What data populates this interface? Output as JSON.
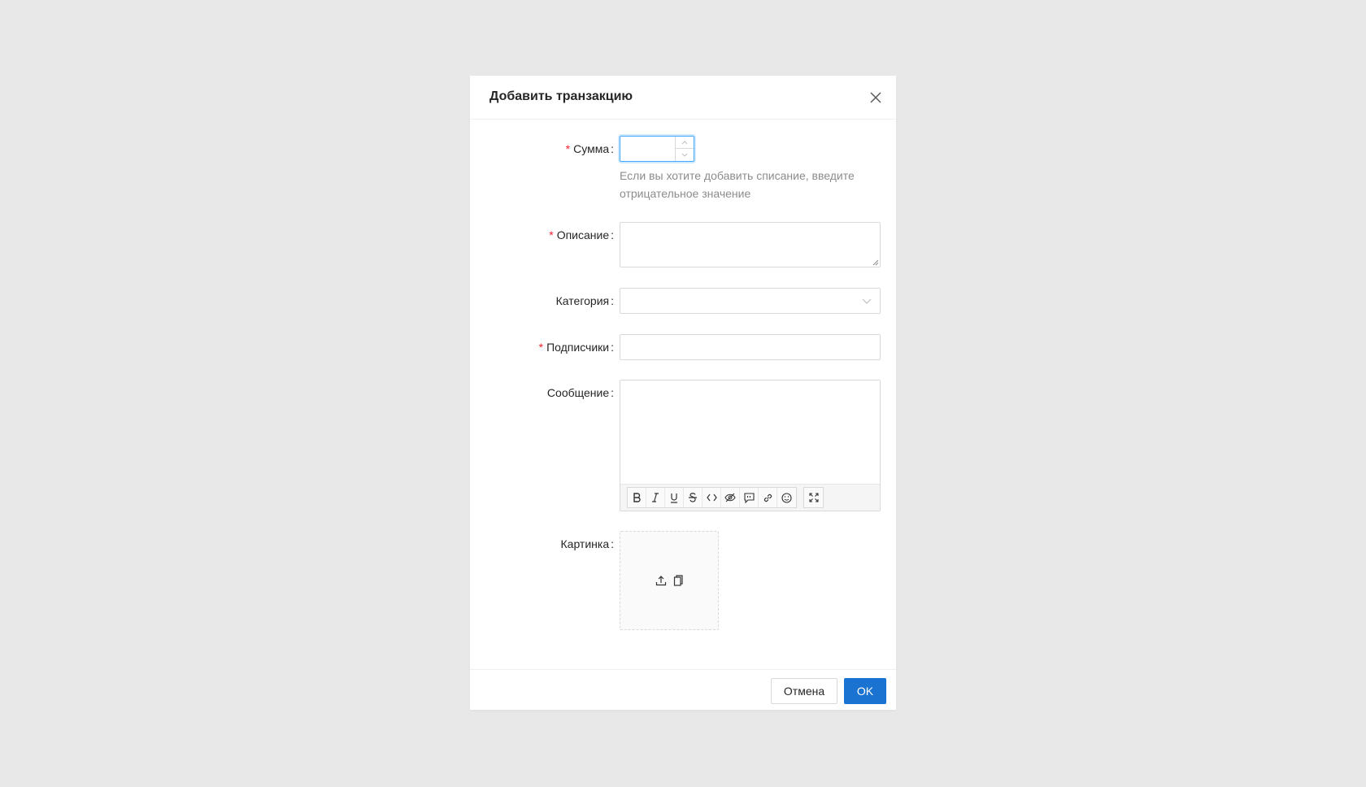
{
  "modal": {
    "title": "Добавить транзакцию",
    "close_icon": "close-icon"
  },
  "form": {
    "amount": {
      "label": "Сумма",
      "required": "*",
      "value": "",
      "help": "Если вы хотите добавить списание, введите отрицательное значение"
    },
    "description": {
      "label": "Описание",
      "required": "*",
      "value": ""
    },
    "category": {
      "label": "Категория",
      "value": ""
    },
    "subscribers": {
      "label": "Подписчики",
      "required": "*",
      "value": ""
    },
    "message": {
      "label": "Сообщение",
      "value": "",
      "toolbar": [
        "bold-icon",
        "italic-icon",
        "underline-icon",
        "strikethrough-icon",
        "code-icon",
        "spoiler-icon",
        "quote-icon",
        "link-icon",
        "emoji-icon",
        "fullscreen-icon"
      ]
    },
    "picture": {
      "label": "Картинка",
      "icons": [
        "upload-icon",
        "paste-icon"
      ]
    }
  },
  "footer": {
    "cancel_label": "Отмена",
    "ok_label": "OK"
  },
  "colors": {
    "primary": "#1a73d1",
    "required": "#f5222d",
    "help_text": "#8c8c8c",
    "background": "#e8e8e8"
  }
}
